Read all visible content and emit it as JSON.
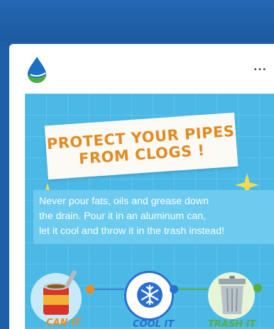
{
  "post": {
    "menu_label": "...",
    "poster": {
      "headline_line1": "PROTECT YOUR PIPES",
      "headline_line2": "FROM CLOGS !",
      "message_lines": [
        "Never pour fats, oils and grease down",
        "the drain. Pour it in an aluminum can,",
        "let it cool and throw it in the trash instead!"
      ],
      "steps": [
        {
          "label": "CAN IT",
          "icon": "can-icon",
          "color": "#f08a1e"
        },
        {
          "label": "COOL IT",
          "icon": "snowflake-icon",
          "color": "#2a6fcf"
        },
        {
          "label": "TRASH IT",
          "icon": "trash-can-icon",
          "color": "#5aae3c"
        }
      ]
    }
  },
  "colors": {
    "topbar": "#1f5fa8",
    "poster_bg": "#4bb9e6",
    "headline": "#e48a22",
    "logo_drop": "#1b6fc4",
    "logo_leaf": "#4cae3e"
  }
}
